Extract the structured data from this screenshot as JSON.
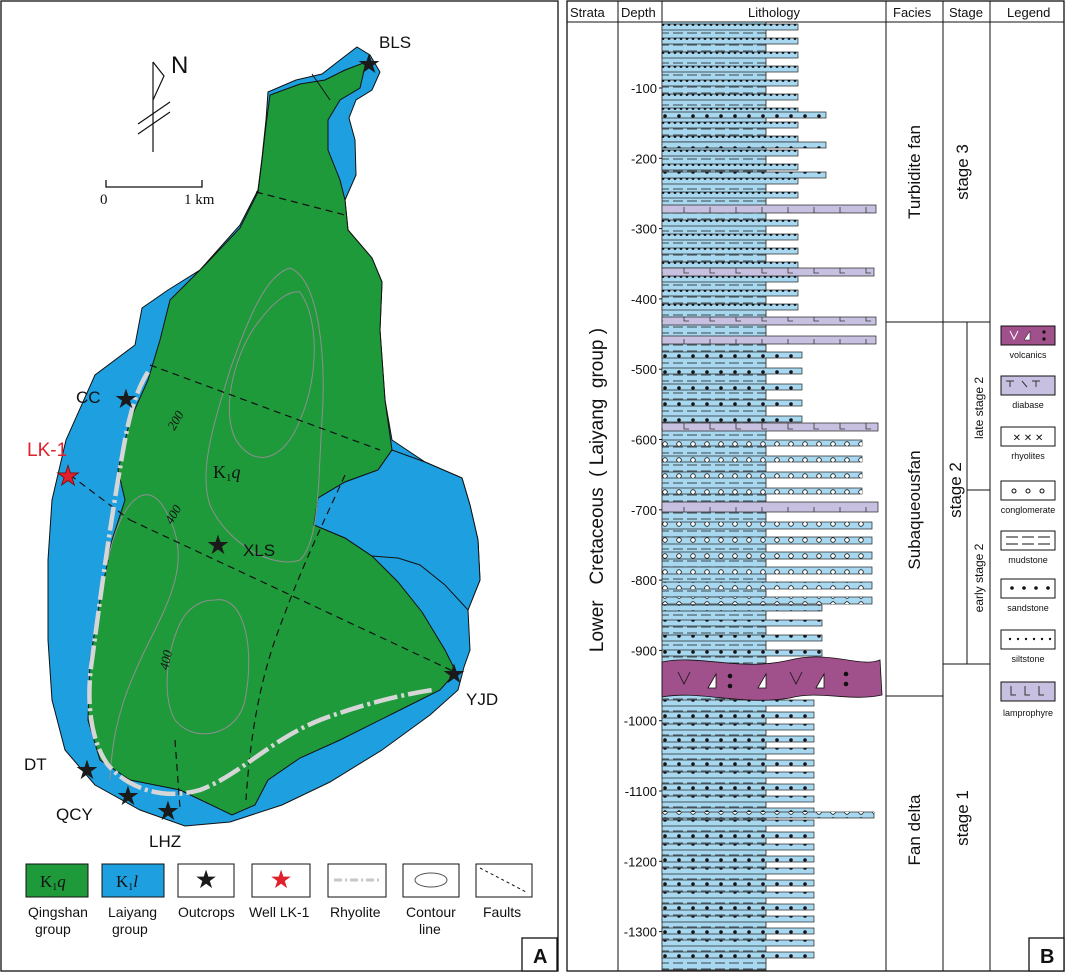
{
  "panel_a": {
    "tag": "A",
    "north": "N",
    "scale": {
      "zero": "0",
      "one": "1 km"
    },
    "unit_label": {
      "base": "K",
      "sub": "1",
      "it": "q"
    },
    "contour_labels": [
      "200",
      "400",
      "400"
    ],
    "sites": {
      "bls": "BLS",
      "cc": "CC",
      "lk1": "LK-1",
      "xls": "XLS",
      "yjd": "YJD",
      "dt": "DT",
      "qcy": "QCY",
      "lhz": "LHZ"
    },
    "legend": {
      "qingshan": {
        "box_base": "K",
        "box_sub": "1",
        "box_it": "q",
        "line1": "Qingshan",
        "line2": "group"
      },
      "laiyang": {
        "box_base": "K",
        "box_sub": "1",
        "box_it": "l",
        "line1": "Laiyang",
        "line2": "group"
      },
      "outcrops": {
        "line1": "Outcrops"
      },
      "well": {
        "line1": "Well LK-1"
      },
      "rhyolite": {
        "line1": "Rhyolite"
      },
      "contour": {
        "line1": "Contour",
        "line2": "line"
      },
      "faults": {
        "line1": "Faults"
      }
    },
    "colors": {
      "qingshan": "#1e9a3b",
      "laiyang": "#1ea0e0",
      "outcrop": "#1a1a1a",
      "well": "#e0202a",
      "rhyolite": "#c8c8c8"
    }
  },
  "panel_b": {
    "tag": "B",
    "headers": {
      "strata": "Strata",
      "depth": "Depth",
      "lithology": "Lithology",
      "facies": "Facies",
      "stage": "Stage",
      "legend": "Legend"
    },
    "strata_text": "Lower   Cretaceous  ( Laiyang  group )",
    "depth_ticks": [
      "-100",
      "-200",
      "-300",
      "-400",
      "-500",
      "-600",
      "-700",
      "-800",
      "-900",
      "-1000",
      "-1100",
      "-1200",
      "-1300"
    ],
    "facies": [
      "Turbidite fan",
      "Subaqueousfan",
      "Fan delta"
    ],
    "stages": [
      "stage 3",
      "stage 2",
      "stage 1"
    ],
    "substages": [
      "late stage 2",
      "early stage 2"
    ],
    "legend_items": [
      "volcanics",
      "diabase",
      "rhyolites",
      "conglomerate",
      "mudstone",
      "sandstone",
      "siltstone",
      "lamprophyre"
    ],
    "colors": {
      "rock": "#a8d8f0",
      "volcanics": "#a0508a",
      "lamprophyre": "#c8c0e0"
    }
  }
}
